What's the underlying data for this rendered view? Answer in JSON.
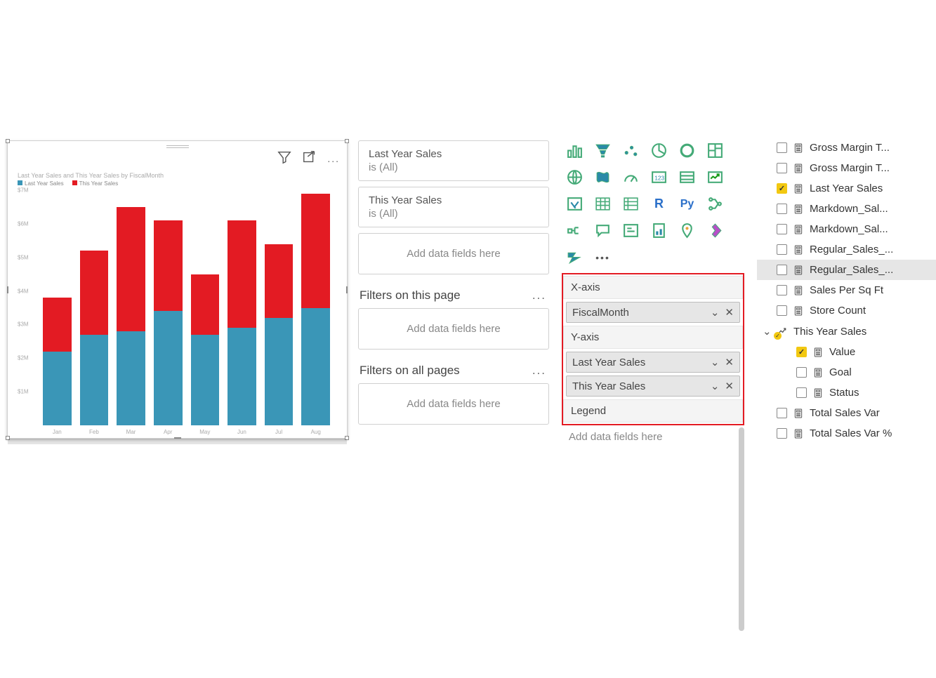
{
  "chart_data": {
    "type": "bar",
    "stacked": true,
    "title": "Last Year Sales and This Year Sales by FiscalMonth",
    "categories": [
      "Jan",
      "Feb",
      "Mar",
      "Apr",
      "May",
      "Jun",
      "Jul",
      "Aug"
    ],
    "series": [
      {
        "name": "Last Year Sales",
        "color": "#3a96b7",
        "values": [
          2.2,
          2.7,
          2.8,
          3.4,
          2.7,
          2.9,
          3.2,
          3.5
        ]
      },
      {
        "name": "This Year Sales",
        "color": "#e31b23",
        "values": [
          1.6,
          2.5,
          3.7,
          2.7,
          1.8,
          3.2,
          2.2,
          3.4
        ]
      }
    ],
    "ylabel": "",
    "ylim": [
      0,
      7
    ],
    "yticks": [
      "$1M",
      "$2M",
      "$3M",
      "$4M",
      "$5M",
      "$6M",
      "$7M"
    ]
  },
  "filters": {
    "visual_filters": [
      {
        "field": "Last Year Sales",
        "state": "is (All)"
      },
      {
        "field": "This Year Sales",
        "state": "is (All)"
      }
    ],
    "add_placeholder": "Add data fields here",
    "page_label": "Filters on this page",
    "all_label": "Filters on all pages"
  },
  "wells": {
    "xaxis_label": "X-axis",
    "yaxis_label": "Y-axis",
    "legend_label": "Legend",
    "xaxis_field": "FiscalMonth",
    "yaxis_fields": [
      "Last Year Sales",
      "This Year Sales"
    ],
    "add_placeholder": "Add data fields here"
  },
  "fields": {
    "items": [
      {
        "label": "Gross Margin T...",
        "checked": false,
        "icon": "calc"
      },
      {
        "label": "Gross Margin T...",
        "checked": false,
        "icon": "calc"
      },
      {
        "label": "Last Year Sales",
        "checked": true,
        "icon": "calc"
      },
      {
        "label": "Markdown_Sal...",
        "checked": false,
        "icon": "calc"
      },
      {
        "label": "Markdown_Sal...",
        "checked": false,
        "icon": "calc"
      },
      {
        "label": "Regular_Sales_...",
        "checked": false,
        "icon": "calc"
      },
      {
        "label": "Regular_Sales_...",
        "checked": false,
        "icon": "calc",
        "selected": true
      },
      {
        "label": "Sales Per Sq Ft",
        "checked": false,
        "icon": "calc"
      },
      {
        "label": "Store Count",
        "checked": false,
        "icon": "calc"
      }
    ],
    "group": {
      "label": "This Year Sales",
      "expanded": true,
      "children": [
        {
          "label": "Value",
          "checked": true
        },
        {
          "label": "Goal",
          "checked": false
        },
        {
          "label": "Status",
          "checked": false
        }
      ]
    },
    "trailing": [
      {
        "label": "Total Sales Var",
        "checked": false,
        "icon": "calc"
      },
      {
        "label": "Total Sales Var %",
        "checked": false,
        "icon": "calc"
      }
    ]
  },
  "labels": {
    "more": "..."
  }
}
